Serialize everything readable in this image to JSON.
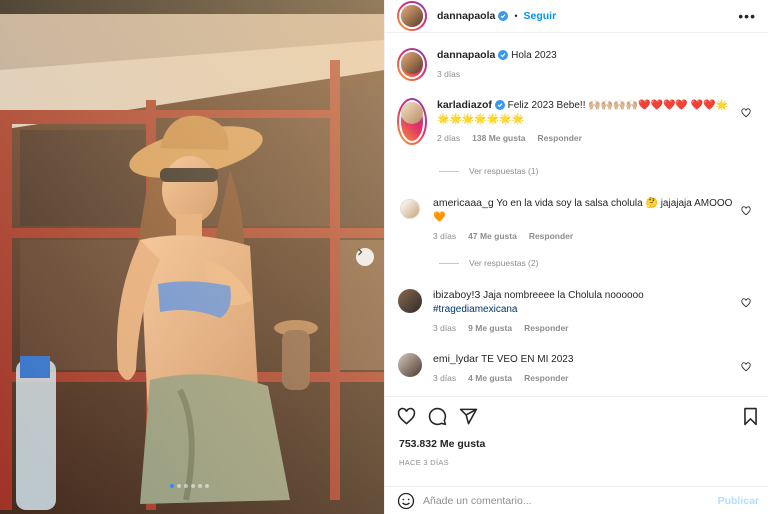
{
  "post": {
    "username": "dannapaola",
    "follow_label": "Seguir",
    "more_label": "•••",
    "caption": "Hola 2023",
    "caption_time": "3 días",
    "likes": "753.832 Me gusta",
    "posted_ago": "HACE 3 DÍAS"
  },
  "comments": [
    {
      "username": "karladiazof",
      "verified": true,
      "text": "Feliz 2023 Bebe!! 🙌🏼🙌🏼🙌🏼🙌🏼❤️❤️❤️❤️ ❤️❤️🌟🌟🌟🌟🌟🌟🌟🌟",
      "time": "2 días",
      "likes": "138 Me gusta",
      "reply_label": "Responder",
      "view_replies": "Ver respuestas (1)"
    },
    {
      "username": "americaaa_g",
      "verified": false,
      "text": "Yo en la vida soy la salsa cholula 🤔 jajajaja AMOOO 🧡",
      "time": "3 días",
      "likes": "47 Me gusta",
      "reply_label": "Responder",
      "view_replies": "Ver respuestas (2)"
    },
    {
      "username": "ibizaboy!3",
      "verified": false,
      "text": "Jaja nombreeee la Cholula noooooo",
      "hashtag": "#tragediamexicana",
      "time": "3 días",
      "likes": "9 Me gusta",
      "reply_label": "Responder"
    },
    {
      "username": "emi_lydar",
      "verified": false,
      "text": "TE VEO EN MI 2023",
      "time": "3 días",
      "likes": "4 Me gusta",
      "reply_label": "Responder"
    }
  ],
  "composer": {
    "placeholder": "Añade un comentario...",
    "post_label": "Publicar"
  },
  "icons": [
    "verified-icon",
    "more-icon",
    "heart-icon",
    "comment-icon",
    "share-icon",
    "bookmark-icon",
    "emoji-icon",
    "chevron-right-icon"
  ],
  "colors": {
    "accent": "#0095f6",
    "verified": "#3897f0",
    "muted": "#8e8e8e"
  },
  "carousel": {
    "slides": 6,
    "active": 0
  }
}
